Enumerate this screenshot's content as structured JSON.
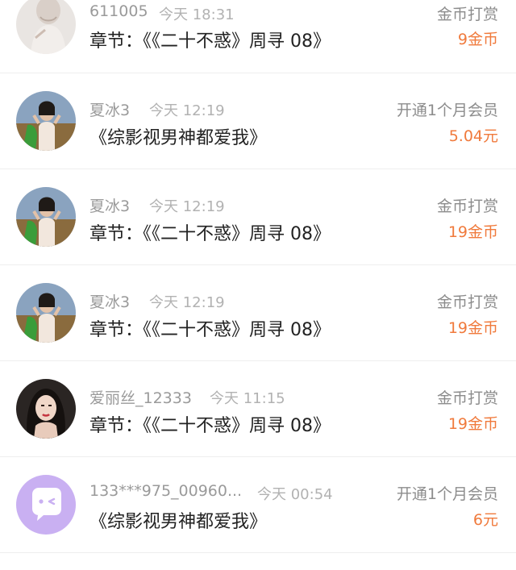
{
  "records": [
    {
      "name": "611005",
      "time": "今天 18:31",
      "content": "章节：《《二十不惑》周寻 08》",
      "type": "金币打赏",
      "amount": "9金币",
      "avatar_icon": "user-avatar-photo"
    },
    {
      "name": "夏冰3",
      "time": "今天 12:19",
      "content": "《综影视男神都爱我》",
      "type": "开通1个月会员",
      "amount": "5.04元",
      "avatar_icon": "user-avatar-photo"
    },
    {
      "name": "夏冰3",
      "time": "今天 12:19",
      "content": "章节：《《二十不惑》周寻 08》",
      "type": "金币打赏",
      "amount": "19金币",
      "avatar_icon": "user-avatar-photo"
    },
    {
      "name": "夏冰3",
      "time": "今天 12:19",
      "content": "章节：《《二十不惑》周寻 08》",
      "type": "金币打赏",
      "amount": "19金币",
      "avatar_icon": "user-avatar-photo"
    },
    {
      "name": "爱丽丝_12333",
      "time": "今天 11:15",
      "content": "章节：《《二十不惑》周寻 08》",
      "type": "金币打赏",
      "amount": "19金币",
      "avatar_icon": "user-avatar-photo"
    },
    {
      "name": "133***975_00960...",
      "time": "今天 00:54",
      "content": "《综影视男神都爱我》",
      "type": "开通1个月会员",
      "amount": "6元",
      "avatar_icon": "chat-bubble-icon"
    }
  ],
  "colors": {
    "amount": "#f07a3c",
    "name": "#9a9a9a",
    "time": "#b2b2b2",
    "content": "#222222",
    "default_avatar_bg": "#c9b0f2"
  }
}
